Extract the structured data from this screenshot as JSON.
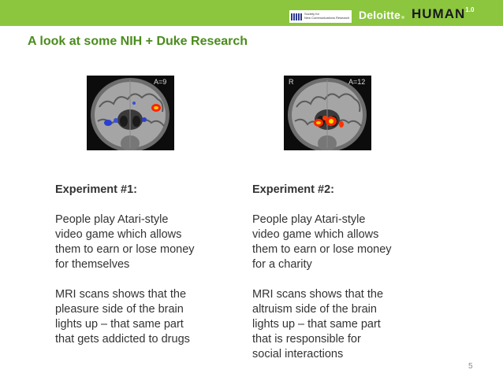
{
  "header": {
    "snr_logo_text": [
      "Society for",
      "New Communications Research"
    ],
    "deloitte_logo": "Deloitte",
    "human_logo": "HUMAN",
    "human_version": "1.0"
  },
  "title": "A look at some NIH + Duke Research",
  "images": {
    "left": {
      "label_right": "A=9"
    },
    "right": {
      "label_left": "R",
      "label_right": "A=12"
    }
  },
  "experiment1": {
    "heading": "Experiment #1:",
    "para1": [
      "People play Atari-style",
      "video game which allows",
      "them to earn or lose money",
      "for themselves"
    ],
    "para2": [
      "MRI scans shows that the",
      "pleasure side of the brain",
      "lights up – that same part",
      "that gets addicted to drugs"
    ]
  },
  "experiment2": {
    "heading": "Experiment #2:",
    "para1": [
      "People play Atari-style",
      "video game which allows",
      "them to earn or lose money",
      "for a charity"
    ],
    "para2": [
      "MRI scans shows that the",
      "altruism side of the brain",
      "lights up – that same part",
      "that is responsible for",
      "social interactions"
    ]
  },
  "page_number": "5",
  "colors": {
    "accent_green": "#8cc63f",
    "title_green": "#4a8c1c"
  }
}
